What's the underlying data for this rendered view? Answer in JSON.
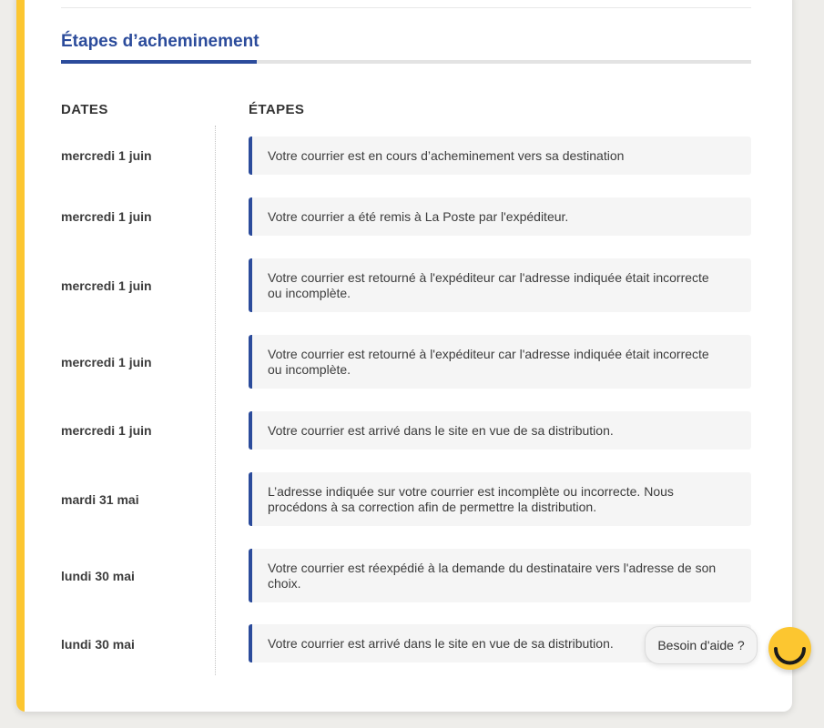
{
  "section": {
    "title": "Étapes d’acheminement"
  },
  "columns": {
    "dates": "DATES",
    "steps": "ÉTAPES"
  },
  "events": [
    {
      "date": "mercredi 1 juin",
      "text": "Votre courrier est en cours d’acheminement vers sa destination"
    },
    {
      "date": "mercredi 1 juin",
      "text": "Votre courrier a été remis à La Poste par l'expéditeur."
    },
    {
      "date": "mercredi 1 juin",
      "text": "Votre courrier est retourné à l'expéditeur car l'adresse indiquée était incorrecte ou incomplète."
    },
    {
      "date": "mercredi 1 juin",
      "text": "Votre courrier est retourné à l'expéditeur car l'adresse indiquée était incorrecte ou incomplète."
    },
    {
      "date": "mercredi 1 juin",
      "text": "Votre courrier est arrivé dans le site en vue de sa distribution."
    },
    {
      "date": "mardi 31 mai",
      "text": "L’adresse indiquée sur votre courrier est incomplète ou incorrecte. Nous procédons à sa correction afin de permettre la distribution."
    },
    {
      "date": "lundi 30 mai",
      "text": "Votre courrier est réexpédié à la demande du destinataire vers l'adresse de son choix."
    },
    {
      "date": "lundi 30 mai",
      "text": "Votre courrier est arrivé dans le site en vue de sa distribution."
    }
  ],
  "help": {
    "label": "Besoin d'aide ?",
    "avatar_icon": "smile-icon"
  },
  "colors": {
    "accent_yellow": "#fcc630",
    "primary_blue": "#2b4b9b",
    "step_background": "#f5f5f5"
  }
}
